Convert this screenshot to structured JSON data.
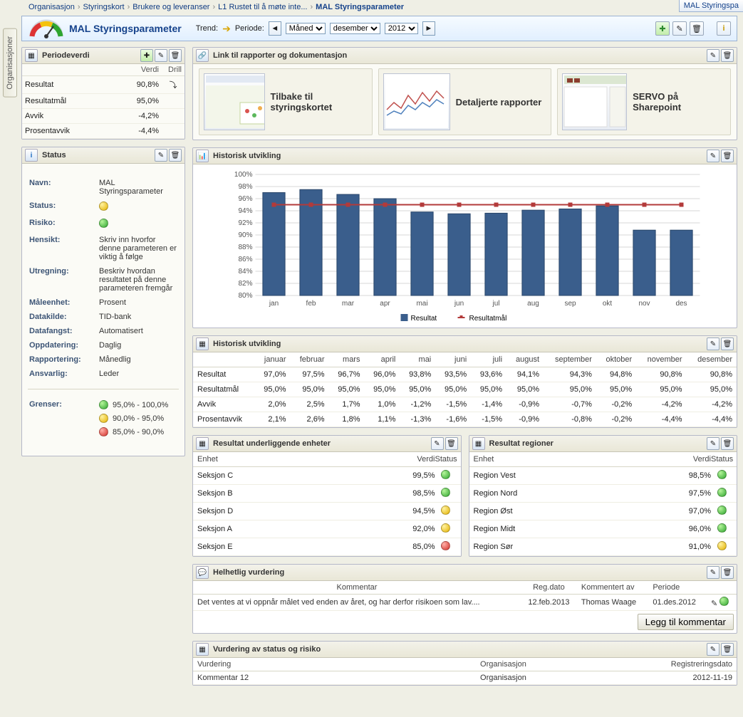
{
  "tabTitle": "MAL Styringspa",
  "breadcrumb": [
    "Organisasjon",
    "Styringskort",
    "Brukere og leveranser",
    "L1 Rustet til å møte inte...",
    "MAL Styringsparameter"
  ],
  "sideTab": "Organisasjoner",
  "titleBar": {
    "title": "MAL Styringsparameter",
    "trendLabel": "Trend:",
    "periodLabel": "Periode:",
    "granularity": "Måned",
    "month": "desember",
    "year": "2012"
  },
  "periodeverdi": {
    "title": "Periodeverdi",
    "headers": [
      "",
      "Verdi",
      "Drill"
    ],
    "rows": [
      {
        "label": "Resultat",
        "value": "90,8%",
        "drill": true
      },
      {
        "label": "Resultatmål",
        "value": "95,0%",
        "drill": false
      },
      {
        "label": "Avvik",
        "value": "-4,2%",
        "drill": false
      },
      {
        "label": "Prosentavvik",
        "value": "-4,4%",
        "drill": false
      }
    ]
  },
  "status": {
    "title": "Status",
    "fields": {
      "Navn": "MAL Styringsparameter",
      "Status": "yellow",
      "Risiko": "green",
      "Hensikt": "Skriv inn hvorfor denne parameteren er viktig å følge",
      "Utregning": "Beskriv hvordan resultatet på denne parameteren fremgår",
      "Måleenhet": "Prosent",
      "Datakilde": "TID-bank",
      "Datafangst": "Automatisert",
      "Oppdatering": "Daglig",
      "Rapportering": "Månedlig",
      "Ansvarlig": "Leder"
    },
    "grenserLabel": "Grenser:",
    "grenser": [
      {
        "color": "green",
        "text": "95,0%  - 100,0%"
      },
      {
        "color": "yellow",
        "text": "90,0%  - 95,0%"
      },
      {
        "color": "red",
        "text": "85,0%  - 90,0%"
      }
    ],
    "labels": {
      "Navn": "Navn:",
      "Status": "Status:",
      "Risiko": "Risiko:",
      "Hensikt": "Hensikt:",
      "Utregning": "Utregning:",
      "Maleenhet": "Måleenhet:",
      "Datakilde": "Datakilde:",
      "Datafangst": "Datafangst:",
      "Oppdatering": "Oppdatering:",
      "Rapportering": "Rapportering:",
      "Ansvarlig": "Ansvarlig:"
    }
  },
  "links": {
    "title": "Link til rapporter og dokumentasjon",
    "cards": [
      {
        "label": "Tilbake til styringskortet"
      },
      {
        "label": "Detaljerte rapporter"
      },
      {
        "label": "SERVO på Sharepoint"
      }
    ]
  },
  "chart_data": {
    "type": "bar",
    "title": "Historisk utvikling",
    "categories": [
      "jan",
      "feb",
      "mar",
      "apr",
      "mai",
      "jun",
      "jul",
      "aug",
      "sep",
      "okt",
      "nov",
      "des"
    ],
    "series": [
      {
        "name": "Resultat",
        "values": [
          97.0,
          97.5,
          96.7,
          96.0,
          93.8,
          93.5,
          93.6,
          94.1,
          94.3,
          94.8,
          90.8,
          90.8
        ]
      },
      {
        "name": "Resultatmål",
        "values": [
          95.0,
          95.0,
          95.0,
          95.0,
          95.0,
          95.0,
          95.0,
          95.0,
          95.0,
          95.0,
          95.0,
          95.0
        ]
      }
    ],
    "ylabel": "%",
    "ylim": [
      80,
      100
    ],
    "legend": [
      "Resultat",
      "Resultatmål"
    ]
  },
  "history": {
    "title": "Historisk utvikling",
    "columns": [
      "",
      "januar",
      "februar",
      "mars",
      "april",
      "mai",
      "juni",
      "juli",
      "august",
      "september",
      "oktober",
      "november",
      "desember"
    ],
    "rows": [
      {
        "label": "Resultat",
        "cells": [
          "97,0%",
          "97,5%",
          "96,7%",
          "96,0%",
          "93,8%",
          "93,5%",
          "93,6%",
          "94,1%",
          "94,3%",
          "94,8%",
          "90,8%",
          "90,8%"
        ]
      },
      {
        "label": "Resultatmål",
        "cells": [
          "95,0%",
          "95,0%",
          "95,0%",
          "95,0%",
          "95,0%",
          "95,0%",
          "95,0%",
          "95,0%",
          "95,0%",
          "95,0%",
          "95,0%",
          "95,0%"
        ]
      },
      {
        "label": "Avvik",
        "cells": [
          "2,0%",
          "2,5%",
          "1,7%",
          "1,0%",
          "-1,2%",
          "-1,5%",
          "-1,4%",
          "-0,9%",
          "-0,7%",
          "-0,2%",
          "-4,2%",
          "-4,2%"
        ]
      },
      {
        "label": "Prosentavvik",
        "cells": [
          "2,1%",
          "2,6%",
          "1,8%",
          "1,1%",
          "-1,3%",
          "-1,6%",
          "-1,5%",
          "-0,9%",
          "-0,8%",
          "-0,2%",
          "-4,4%",
          "-4,4%"
        ]
      }
    ]
  },
  "units": {
    "title": "Resultat underliggende enheter",
    "headers": {
      "name": "Enhet",
      "value": "Verdi",
      "status": "Status"
    },
    "rows": [
      {
        "name": "Seksjon C",
        "value": "99,5%",
        "status": "green"
      },
      {
        "name": "Seksjon B",
        "value": "98,5%",
        "status": "green"
      },
      {
        "name": "Seksjon D",
        "value": "94,5%",
        "status": "yellow"
      },
      {
        "name": "Seksjon A",
        "value": "92,0%",
        "status": "yellow"
      },
      {
        "name": "Seksjon E",
        "value": "85,0%",
        "status": "red"
      }
    ]
  },
  "regions": {
    "title": "Resultat regioner",
    "headers": {
      "name": "Enhet",
      "value": "Verdi",
      "status": "Status"
    },
    "rows": [
      {
        "name": "Region Vest",
        "value": "98,5%",
        "status": "green"
      },
      {
        "name": "Region Nord",
        "value": "97,5%",
        "status": "green"
      },
      {
        "name": "Region Øst",
        "value": "97,0%",
        "status": "green"
      },
      {
        "name": "Region Midt",
        "value": "96,0%",
        "status": "green"
      },
      {
        "name": "Region Sør",
        "value": "91,0%",
        "status": "yellow"
      }
    ]
  },
  "vurdering": {
    "title": "Helhetlig vurdering",
    "columns": [
      "Kommentar",
      "Reg.dato",
      "Kommentert av",
      "Periode",
      ""
    ],
    "rows": [
      {
        "comment": "Det ventes at vi oppnår målet ved enden av året, og har derfor risikoen som lav....",
        "date": "12.feb.2013",
        "by": "Thomas Waage",
        "period": "01.des.2012"
      }
    ],
    "addBtn": "Legg til kommentar"
  },
  "statusRisiko": {
    "title": "Vurdering av status og risiko",
    "columns": [
      "Vurdering",
      "Organisasjon",
      "Registreringsdato"
    ],
    "rows": [
      {
        "v": "Kommentar 12",
        "o": "Organisasjon",
        "d": "2012-11-19"
      }
    ]
  }
}
